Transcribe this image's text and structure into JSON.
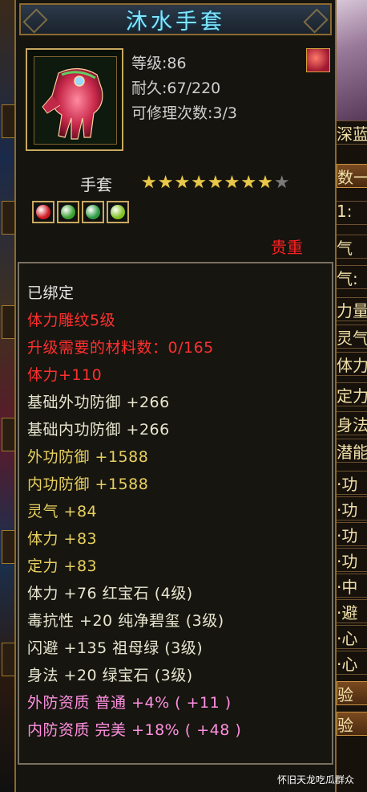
{
  "item": {
    "name": "沐水手套",
    "level": "等级:86",
    "durability": "耐久:67/220",
    "repair": "可修理次数:3/3",
    "type": "手套",
    "stars_total": 9,
    "stars_filled": 8,
    "rarity": "贵重",
    "icon": "red-gauntlet-icon"
  },
  "gems": [
    {
      "name": "ruby-socket-icon",
      "color": "#d01820"
    },
    {
      "name": "emerald-socket-icon",
      "color": "#3aa030"
    },
    {
      "name": "emerald-socket-icon",
      "color": "#2a9a40"
    },
    {
      "name": "jade-socket-icon",
      "color": "#80c020"
    }
  ],
  "attributes": [
    {
      "text": "已绑定",
      "color": "white"
    },
    {
      "text": "体力雕纹5级",
      "color": "red"
    },
    {
      "text": "升级需要的材料数：0/165",
      "color": "red"
    },
    {
      "text": "体力+110",
      "color": "red"
    },
    {
      "text": "基础外功防御  +266",
      "color": "light"
    },
    {
      "text": "基础内功防御  +266",
      "color": "light"
    },
    {
      "text": "外功防御  +1588",
      "color": "gold"
    },
    {
      "text": "内功防御  +1588",
      "color": "gold"
    },
    {
      "text": "灵气  +84",
      "color": "gold"
    },
    {
      "text": "体力  +83",
      "color": "gold"
    },
    {
      "text": "定力  +83",
      "color": "gold"
    },
    {
      "text": "体力  +76  红宝石 (4级)",
      "color": "light"
    },
    {
      "text": "毒抗性  +20  纯净碧玺 (3级)",
      "color": "light"
    },
    {
      "text": "闪避  +135  祖母绿 (3级)",
      "color": "light"
    },
    {
      "text": "身法  +20  绿宝石 (3级)",
      "color": "light"
    },
    {
      "text": "外防资质    普通  +4% ( +11 )",
      "color": "pink"
    },
    {
      "text": "内防资质    完美  +18% ( +48 )",
      "color": "pink"
    }
  ],
  "side_panel": [
    "深蓝",
    "数一",
    "1:",
    "气",
    "气:",
    "力量",
    "灵气",
    "体力",
    "定力",
    "身法",
    "潜能",
    "·功",
    "·功",
    "·功",
    "·功",
    "·中",
    "·避",
    "·心",
    "·心",
    "验",
    "验"
  ],
  "watermark": "怀旧天龙吃瓜群众"
}
